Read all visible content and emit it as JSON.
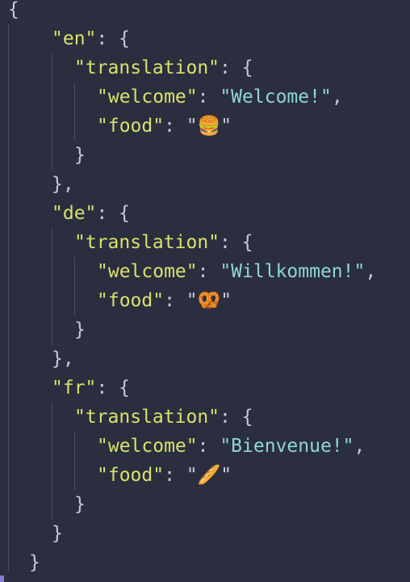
{
  "editor": {
    "lines": [
      {
        "indent": 0,
        "parts": [
          {
            "t": "{",
            "c": "punc"
          }
        ]
      },
      {
        "indent": 2,
        "parts": [
          {
            "t": "\"en\"",
            "c": "key"
          },
          {
            "t": ": {",
            "c": "punc"
          }
        ]
      },
      {
        "indent": 3,
        "parts": [
          {
            "t": "\"translation\"",
            "c": "key"
          },
          {
            "t": ": {",
            "c": "punc"
          }
        ]
      },
      {
        "indent": 4,
        "parts": [
          {
            "t": "\"welcome\"",
            "c": "key"
          },
          {
            "t": ": ",
            "c": "punc"
          },
          {
            "t": "\"Welcome!\"",
            "c": "str"
          },
          {
            "t": ",",
            "c": "punc"
          }
        ]
      },
      {
        "indent": 4,
        "parts": [
          {
            "t": "\"food\"",
            "c": "key"
          },
          {
            "t": ": \"",
            "c": "punc"
          },
          {
            "t": "🍔",
            "c": "emoji"
          },
          {
            "t": "\"",
            "c": "punc"
          }
        ]
      },
      {
        "indent": 3,
        "parts": [
          {
            "t": "}",
            "c": "punc"
          }
        ]
      },
      {
        "indent": 2,
        "parts": [
          {
            "t": "},",
            "c": "punc"
          }
        ]
      },
      {
        "indent": 2,
        "parts": [
          {
            "t": "\"de\"",
            "c": "key"
          },
          {
            "t": ": {",
            "c": "punc"
          }
        ]
      },
      {
        "indent": 3,
        "parts": [
          {
            "t": "\"translation\"",
            "c": "key"
          },
          {
            "t": ": {",
            "c": "punc"
          }
        ]
      },
      {
        "indent": 4,
        "parts": [
          {
            "t": "\"welcome\"",
            "c": "key"
          },
          {
            "t": ": ",
            "c": "punc"
          },
          {
            "t": "\"Willkommen!\"",
            "c": "str"
          },
          {
            "t": ",",
            "c": "punc"
          }
        ]
      },
      {
        "indent": 4,
        "parts": [
          {
            "t": "\"food\"",
            "c": "key"
          },
          {
            "t": ": \"",
            "c": "punc"
          },
          {
            "t": "🥨",
            "c": "emoji"
          },
          {
            "t": "\"",
            "c": "punc"
          }
        ]
      },
      {
        "indent": 3,
        "parts": [
          {
            "t": "}",
            "c": "punc"
          }
        ]
      },
      {
        "indent": 2,
        "parts": [
          {
            "t": "},",
            "c": "punc"
          }
        ]
      },
      {
        "indent": 2,
        "parts": [
          {
            "t": "\"fr\"",
            "c": "key"
          },
          {
            "t": ": {",
            "c": "punc"
          }
        ]
      },
      {
        "indent": 3,
        "parts": [
          {
            "t": "\"translation\"",
            "c": "key"
          },
          {
            "t": ": {",
            "c": "punc"
          }
        ]
      },
      {
        "indent": 4,
        "parts": [
          {
            "t": "\"welcome\"",
            "c": "key"
          },
          {
            "t": ": ",
            "c": "punc"
          },
          {
            "t": "\"Bienvenue!\"",
            "c": "str"
          },
          {
            "t": ",",
            "c": "punc"
          }
        ]
      },
      {
        "indent": 4,
        "parts": [
          {
            "t": "\"food\"",
            "c": "key"
          },
          {
            "t": ": \"",
            "c": "punc"
          },
          {
            "t": "🥖",
            "c": "emoji"
          },
          {
            "t": "\"",
            "c": "punc"
          }
        ]
      },
      {
        "indent": 3,
        "parts": [
          {
            "t": "}",
            "c": "punc"
          }
        ]
      },
      {
        "indent": 2,
        "parts": [
          {
            "t": "}",
            "c": "punc"
          }
        ]
      },
      {
        "indent": 1,
        "parts": [
          {
            "t": "}",
            "c": "punc"
          }
        ]
      }
    ]
  },
  "colors": {
    "background": "#2b2e3f",
    "key": "#d9e26b",
    "string": "#8fd6d6",
    "punctuation": "#c6cad8",
    "indent_guide": "#4a4e63"
  }
}
